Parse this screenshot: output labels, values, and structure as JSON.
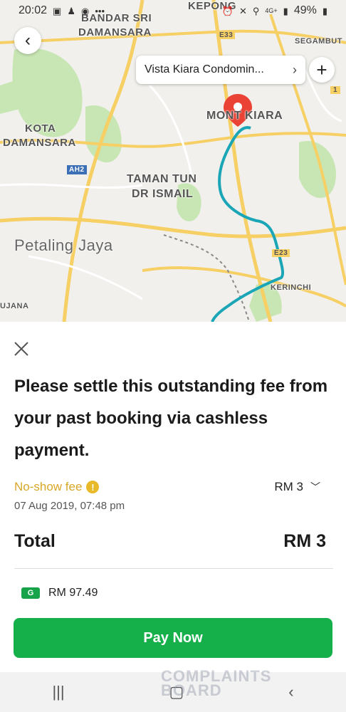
{
  "status_bar": {
    "time": "20:02",
    "battery": "49%",
    "network": "4G+"
  },
  "map": {
    "labels": {
      "kepong": "KEPONG",
      "bandar_sri": "BANDAR SRI",
      "damansara_top": "DAMANSARA",
      "kota": "KOTA",
      "kota_damansara": "DAMANSARA",
      "taman_tun": "TAMAN TUN",
      "dr_ismail": "DR ISMAIL",
      "mont_kiara": "MONT KIARA",
      "petaling_jaya": "Petaling Jaya",
      "segambut": "SEGAMBUT",
      "kerinchi": "KERINCHI",
      "ujana": "UJANA",
      "e33": "E33",
      "e23": "E23",
      "ah2": "AH2",
      "one": "1"
    }
  },
  "destination": {
    "label": "Vista Kiara Condomin..."
  },
  "sheet": {
    "headline": "Please settle this outstanding fee from your past booking via cashless payment.",
    "fee_label": "No-show fee",
    "fee_amount": "RM 3",
    "fee_date": "07 Aug 2019, 07:48 pm",
    "total_label": "Total",
    "total_amount": "RM 3",
    "wallet_badge": "G",
    "wallet_balance": "RM 97.49",
    "pay_button": "Pay Now"
  },
  "watermark": {
    "line1": "COMPLAINTS",
    "line2": "BOARD"
  },
  "colors": {
    "accent_green": "#16b04a",
    "warning_yellow": "#d9a728",
    "route": "#1aa6b7",
    "pin": "#ea4335"
  }
}
